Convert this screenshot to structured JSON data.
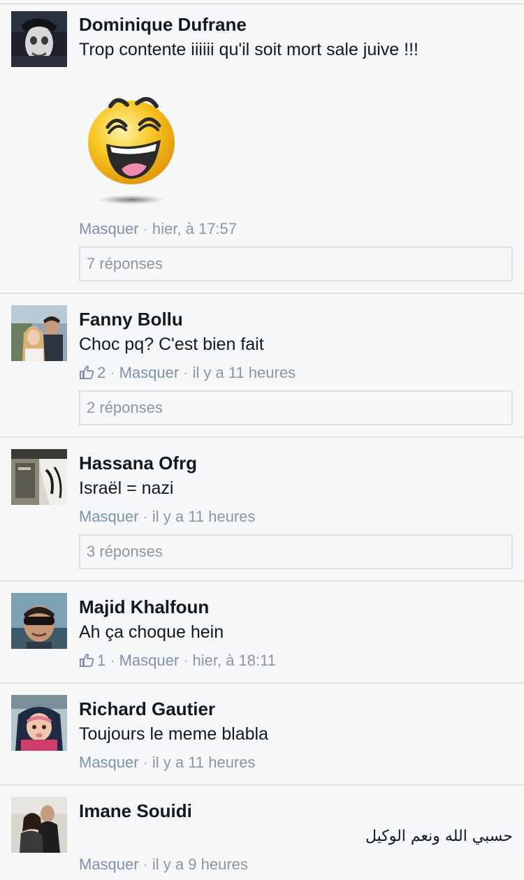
{
  "comments": [
    {
      "author": "Dominique Dufrane",
      "text": "Trop contente iiiiii qu'il soit mort sale juive !!!",
      "sticker": "laughing-emoji-sticker",
      "hide_label": "Masquer",
      "separator": "·",
      "time": "hier, à 17:57",
      "replies": "7 réponses"
    },
    {
      "author": "Fanny Bollu",
      "text": "Choc pq? C'est bien fait",
      "likes": "2",
      "hide_label": "Masquer",
      "separator": "·",
      "time": "il y a 11 heures",
      "replies": "2 réponses"
    },
    {
      "author": "Hassana Ofrg",
      "text": "Israël = nazi",
      "hide_label": "Masquer",
      "separator": "·",
      "time": "il y a 11 heures",
      "replies": "3 réponses"
    },
    {
      "author": "Majid Khalfoun",
      "text": "Ah ça choque hein",
      "likes": "1",
      "hide_label": "Masquer",
      "separator": "·",
      "time": "hier, à 18:11"
    },
    {
      "author": "Richard Gautier",
      "text": "Toujours le meme blabla",
      "hide_label": "Masquer",
      "separator": "·",
      "time": "il y a 11 heures"
    },
    {
      "author": "Imane Souidi",
      "text": "حسبي الله ونعم الوكيل",
      "hide_label": "Masquer",
      "separator": "·",
      "time": "il y a 9 heures"
    }
  ],
  "icons": {
    "like": "thumbs-up-icon",
    "avatar": "profile-photo"
  },
  "colors": {
    "background": "#f6f7f9",
    "name": "#141823",
    "link": "#7f90ae",
    "meta": "#90949c",
    "divider": "#dfe1e5"
  }
}
